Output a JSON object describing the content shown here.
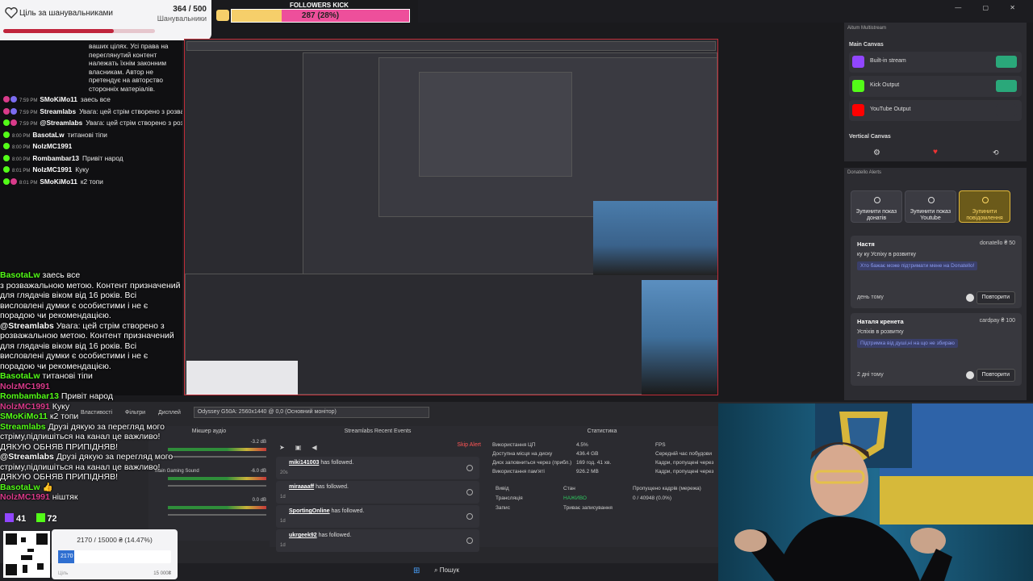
{
  "goal": {
    "title": "Ціль за шанувальниками",
    "count": "364 / 500",
    "subtitle": "Шанувальники",
    "progress": 0.73
  },
  "kick_goal": {
    "label": "FOLLOWERS KICK",
    "value": "287 (28%)",
    "progress": 0.28
  },
  "chat": {
    "header_text": "ваших цілях. Усі права на переглянутий контент належать їхнім законним власникам. Автор не претендує на авторство сторонніх матеріалів.",
    "messages": [
      {
        "time": "7:59 PM",
        "name": "SMoKiMo11",
        "color": "#ffffff",
        "text": "заесь все",
        "icons": [
          "#d93b8a",
          "#7b6cf0"
        ]
      },
      {
        "time": "7:59 PM",
        "name": "Streamlabs",
        "color": "#ffffff",
        "text": "Увага: цей стрім створено з розважальною метою. Контент призначений для глядачів віком від 16 років. Всі висловлені думки є особистими і не є порадою чи рекомендацією.",
        "icons": [
          "#d93b8a",
          "#7b6cf0"
        ]
      },
      {
        "time": "7:59 PM",
        "name": "@Streamlabs",
        "color": "#ffffff",
        "text": "Увага: цей стрім створено з розважальною метою. Контент призначений для глядачів віком від 16 років. Всі висловлені думки є особистими і не є порадою чи рекомендацією.",
        "icons": [
          "#53fc18",
          "#d93b8a"
        ]
      },
      {
        "time": "8:00 PM",
        "name": "BasotaLw",
        "color": "#ffffff",
        "text": "титанові тіпи",
        "icons": [
          "#53fc18"
        ]
      },
      {
        "time": "8:00 PM",
        "name": "NolzMC1991",
        "color": "#ffffff",
        "text": "",
        "icons": [
          "#53fc18"
        ]
      },
      {
        "time": "8:00 PM",
        "name": "Rombambar13",
        "color": "#ffffff",
        "text": "Привіт народ",
        "icons": [
          "#53fc18"
        ]
      },
      {
        "time": "8:01 PM",
        "name": "NolzMC1991",
        "color": "#ffffff",
        "text": "Куку",
        "icons": [
          "#53fc18"
        ]
      },
      {
        "time": "8:01 PM",
        "name": "SMoKiMo11",
        "color": "#ffffff",
        "text": "к2 топи",
        "icons": [
          "#53fc18",
          "#d93b8a"
        ]
      }
    ]
  },
  "overlay_chat": [
    {
      "name": "BasotaLw",
      "text": "заесь все",
      "color": "#53fc18"
    },
    {
      "name": "",
      "text": "з розважальною метою. Контент призначений для глядачів віком від 16 років. Всі висловлені думки є особистими і не є порадою чи рекомендацією.",
      "color": "#ffffff"
    },
    {
      "name": "@Streamlabs",
      "text": "Увага: цей стрім створено з розважальною метою. Контент призначений для глядачів віком від 16 років. Всі висловлені думки є особистими і не є порадою чи рекомендацією.",
      "color": "#ffffff"
    },
    {
      "name": "BasotaLw",
      "text": "титанові тіпи",
      "color": "#53fc18"
    },
    {
      "name": "NolzMC1991",
      "text": "",
      "color": "#d93b8a"
    },
    {
      "name": "Rombambar13",
      "text": "Привіт народ",
      "color": "#53fc18"
    },
    {
      "name": "NolzMC1991",
      "text": "Куку",
      "color": "#d93b8a"
    },
    {
      "name": "SMoKiMo11",
      "text": "к2 топи",
      "color": "#53fc18"
    },
    {
      "name": "Streamlabs",
      "text": "Друзі дякую за перегляд мого стріму,підпишіться на канал це важливо! ДЯКУЮ ОБНЯВ ПРИПІДНЯВ!",
      "color": "#53fc18"
    },
    {
      "name": "@Streamlabs",
      "text": "Друзі дякую за перегляд мого стріму,підпишіться на канал це важливо! ДЯКУЮ ОБНЯВ ПРИПІДНЯВ!",
      "color": "#ffffff"
    },
    {
      "name": "BasotaLw",
      "text": "👍",
      "color": "#53fc18"
    },
    {
      "name": "NolzMC1991",
      "text": "ніштяк",
      "color": "#d93b8a"
    }
  ],
  "viewer_stats": {
    "twitch": "41",
    "kick": "72"
  },
  "donation_goal": {
    "title": "2170 / 15000 ₴ (14.47%)",
    "value": "2170",
    "progress": 0.1447,
    "left_label": "Ціль",
    "right_label": "15 000₴"
  },
  "multistream": {
    "header": "Aitum Multistream",
    "main_canvas": "Main Canvas",
    "outputs": [
      {
        "label": "Built-in stream",
        "color": "#9146ff"
      },
      {
        "label": "Kick Output",
        "color": "#53fc18"
      },
      {
        "label": "YouTube Output",
        "color": "#ff0000"
      }
    ],
    "vertical_canvas": "Vertical Canvas"
  },
  "donatello": {
    "header": "Donatello Alerts",
    "buttons": [
      "Зупинити показ донатів",
      "Зупинити показ Youtube",
      "Зупинити повідомлення"
    ],
    "alerts": [
      {
        "name": "Настя",
        "source": "donatello ₴ 50",
        "message": "ку ку Успіху в розвитку",
        "highlight": "Хто бажає може підтримати мене на Donatello!",
        "time": "день тому",
        "replay": "Повторити"
      },
      {
        "name": "Наталя кренета",
        "source": "cardpay ₴ 100",
        "message": "Успіхів в розвитку",
        "highlight": "Підтримка від душі,ні на що не збираю",
        "time": "2 дні тому",
        "replay": "Повторити"
      }
    ]
  },
  "obs": {
    "tabs": [
      "Властивості",
      "Фільтри",
      "Дисплей"
    ],
    "display_select": "Odyssey G50A: 2560x1440 @ 0,0 (Основний монітор)",
    "mixer": {
      "title": "Мікшер аудіо",
      "channels": [
        {
          "name": "",
          "db": "-3.2 dB"
        },
        {
          "name": "Main Gaming Sound",
          "db": "-6.0 dB"
        },
        {
          "name": "",
          "db": "0.0 dB"
        }
      ]
    },
    "events": {
      "title": "Streamlabs Recent Events",
      "skip": "Skip Alert",
      "items": [
        {
          "user": "miki141003",
          "action": "has followed.",
          "ago": "20s"
        },
        {
          "user": "miraaaaff",
          "action": "has followed.",
          "ago": "1d"
        },
        {
          "user": "SportingOnline",
          "action": "has followed.",
          "ago": "1d"
        },
        {
          "user": "ukrgeek92",
          "action": "has followed.",
          "ago": "1d"
        }
      ]
    },
    "stats": {
      "title": "Статистика",
      "rows": [
        {
          "k": "Використання ЦП",
          "v": "4.5%"
        },
        {
          "k": "Доступна місця на диску",
          "v": "436.4 GB"
        },
        {
          "k": "Диск заповниться через (прибл.)",
          "v": "169 год. 41 хв."
        },
        {
          "k": "Використання пам'яті",
          "v": "926.2 MB"
        }
      ],
      "right": [
        "FPS",
        "Середній час побудови",
        "Кадри, пропущені через",
        "Кадри, пропущені через"
      ],
      "table_headers": [
        "Вивід",
        "Стан",
        "Пропущено кадрів (мережа)"
      ],
      "table_rows": [
        {
          "out": "Трансляція",
          "state": "НАЖИВО",
          "drop": "0 / 40948 (0.0%)"
        },
        {
          "out": "Запис",
          "state": "Триває записування",
          "drop": ""
        }
      ]
    }
  },
  "taskbar": {
    "search": "Пошук"
  }
}
